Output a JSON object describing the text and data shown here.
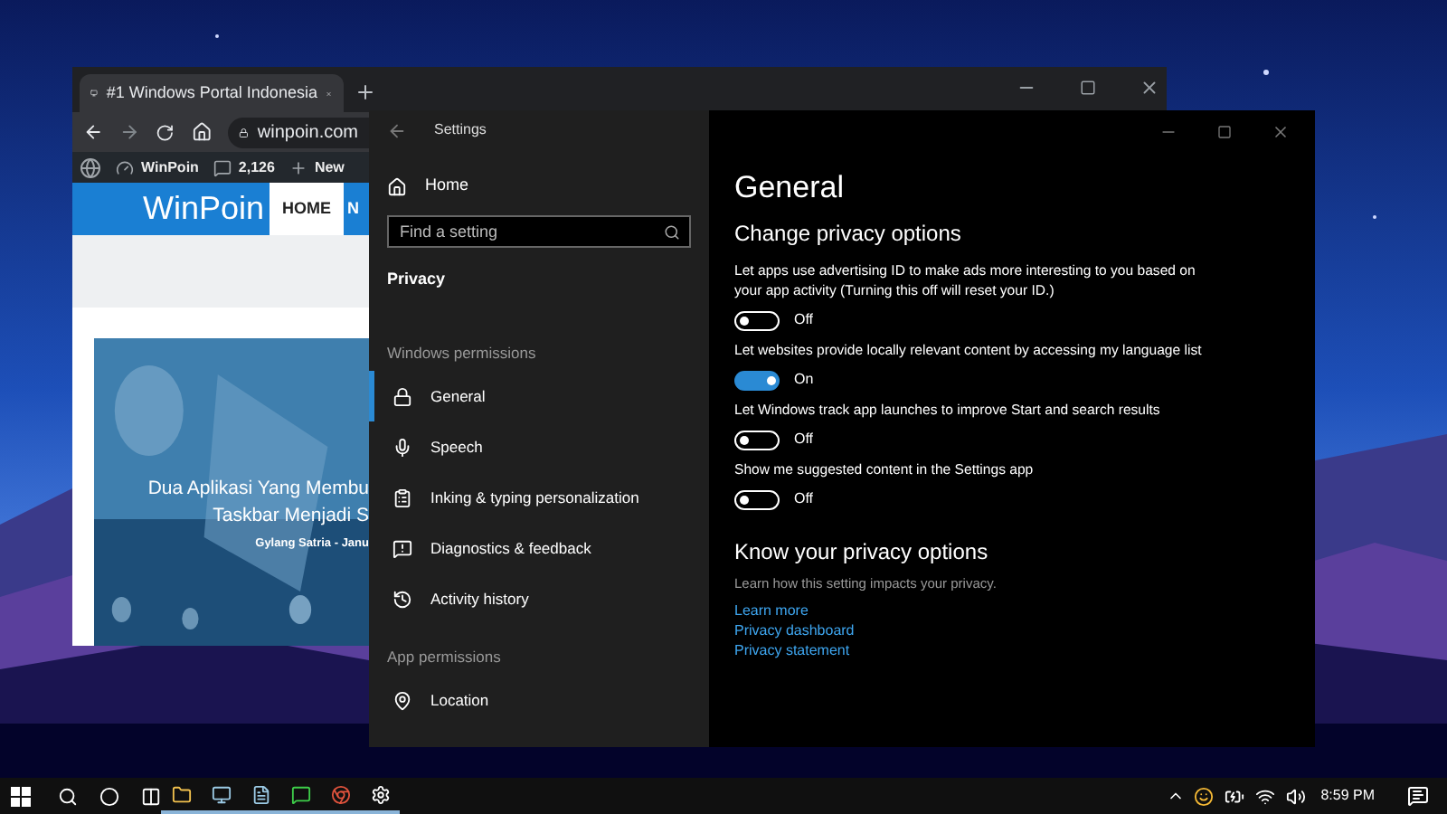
{
  "browser": {
    "tab": {
      "title": "#1 Windows Portal Indonesia"
    },
    "address": "winpoin.com",
    "admin_bar": [
      {
        "label": "WinPoin"
      },
      {
        "label": "2,126"
      },
      {
        "label": "New"
      }
    ],
    "site": {
      "logo": "WinPoin",
      "nav": [
        {
          "label": "HOME",
          "selected": true
        },
        {
          "label": "N",
          "selected": false
        }
      ]
    },
    "article": {
      "title_lines": [
        "Dua Aplikasi Yang Membu",
        "Taskbar Menjadi S"
      ],
      "byline": "Gylang Satria - Janu"
    }
  },
  "settings": {
    "title": "Settings",
    "home": "Home",
    "search": {
      "placeholder": "Find a setting"
    },
    "section": "Privacy",
    "groups": [
      {
        "heading": "Windows permissions",
        "items": [
          {
            "label": "General",
            "selected": true
          },
          {
            "label": "Speech",
            "selected": false
          },
          {
            "label": "Inking & typing personalization",
            "selected": false
          },
          {
            "label": "Diagnostics & feedback",
            "selected": false
          },
          {
            "label": "Activity history",
            "selected": false
          }
        ]
      },
      {
        "heading": "App permissions",
        "items": [
          {
            "label": "Location",
            "selected": false
          }
        ]
      }
    ],
    "page_title": "General",
    "subheading": "Change privacy options",
    "options": [
      {
        "text": "Let apps use advertising ID to make ads more interesting to you based on your app activity (Turning this off will reset your ID.)",
        "on": false,
        "state_label": "Off"
      },
      {
        "text": "Let websites provide locally relevant content by accessing my language list",
        "on": true,
        "state_label": "On"
      },
      {
        "text": "Let Windows track app launches to improve Start and search results",
        "on": false,
        "state_label": "Off"
      },
      {
        "text": "Show me suggested content in the Settings app",
        "on": false,
        "state_label": "Off"
      }
    ],
    "know": {
      "heading": "Know your privacy options",
      "text": "Learn how this setting impacts your privacy.",
      "links": [
        "Learn more",
        "Privacy dashboard",
        "Privacy statement"
      ]
    }
  },
  "taskbar": {
    "clock": "8:59 PM"
  }
}
